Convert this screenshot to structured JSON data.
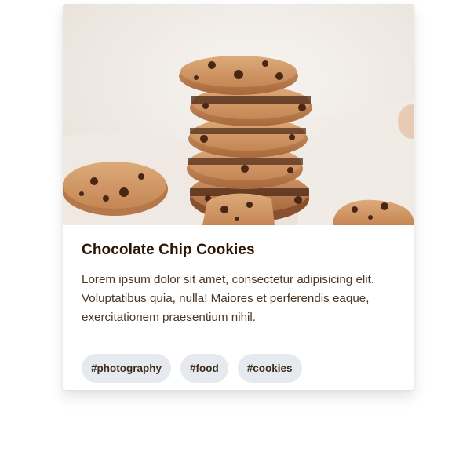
{
  "card": {
    "image_alt": "Stack of chocolate chip cookies",
    "title": "Chocolate Chip Cookies",
    "description": "Lorem ipsum dolor sit amet, consectetur adipisicing elit. Voluptatibus quia, nulla! Maiores et perferendis eaque, exercitationem praesentium nihil.",
    "tags": [
      "#photography",
      "#food",
      "#cookies"
    ]
  },
  "colors": {
    "title": "#2a1607",
    "text": "#4b3623",
    "tag_bg": "#e6e9ee",
    "tag_text": "#3b2b1c"
  }
}
